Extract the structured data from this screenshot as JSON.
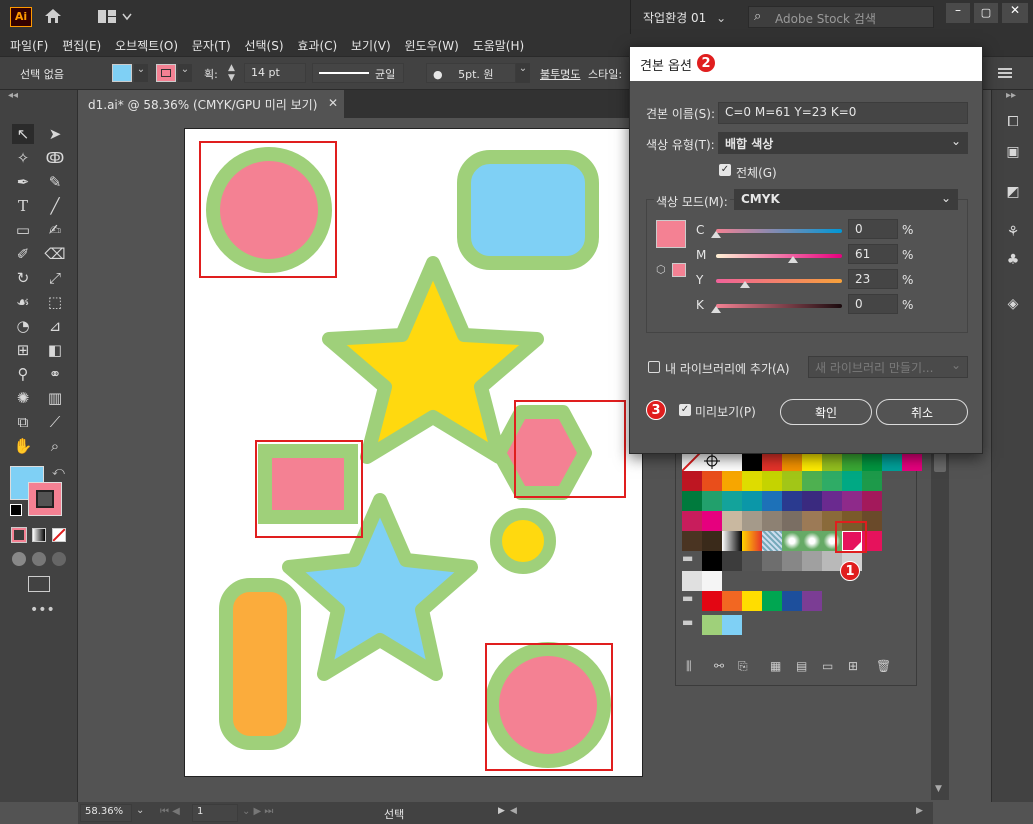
{
  "app": {
    "logo": "Ai",
    "workspace": "작업환경 01",
    "search_placeholder": "Adobe Stock 검색"
  },
  "menu": [
    "파일(F)",
    "편집(E)",
    "오브젝트(O)",
    "문자(T)",
    "선택(S)",
    "효과(C)",
    "보기(V)",
    "윈도우(W)",
    "도움말(H)"
  ],
  "control": {
    "selection": "선택 없음",
    "stroke_label": "획:",
    "stroke_weight": "14 pt",
    "stroke_profile": "균일",
    "brush": "5pt. 원",
    "opacity_label": "불투명도",
    "style_label": "스타일:"
  },
  "document": {
    "tab_title": "d1.ai* @ 58.36% (CMYK/GPU 미리 보기)"
  },
  "status": {
    "zoom": "58.36%",
    "artboard": "1",
    "mode": "선택"
  },
  "dialog": {
    "title": "견본 옵션",
    "name_label": "견본 이름(S):",
    "name_value": "C=0 M=61 Y=23 K=0",
    "type_label": "색상 유형(T):",
    "type_value": "배합 색상",
    "global_label": "전체(G)",
    "mode_label": "색상 모드(M):",
    "mode_value": "CMYK",
    "channels": [
      {
        "label": "C",
        "value": "0",
        "unit": "%"
      },
      {
        "label": "M",
        "value": "61",
        "unit": "%"
      },
      {
        "label": "Y",
        "value": "23",
        "unit": "%"
      },
      {
        "label": "K",
        "value": "0",
        "unit": "%"
      }
    ],
    "library_label": "내 라이브러리에 추가(A)",
    "library_placeholder": "새 라이브러리 만들기...",
    "preview_label": "미리보기(P)",
    "ok_label": "확인",
    "cancel_label": "취소",
    "preview_color": "#f48193"
  },
  "annotations": {
    "one": "1",
    "two": "2",
    "three": "3"
  },
  "colors": {
    "stroke_green": "#9fd07a",
    "pink": "#f48193",
    "blue": "#7fd0f5",
    "yellow": "#ffd90f",
    "orange": "#fbac3c",
    "highlight": "#e01e1e"
  }
}
